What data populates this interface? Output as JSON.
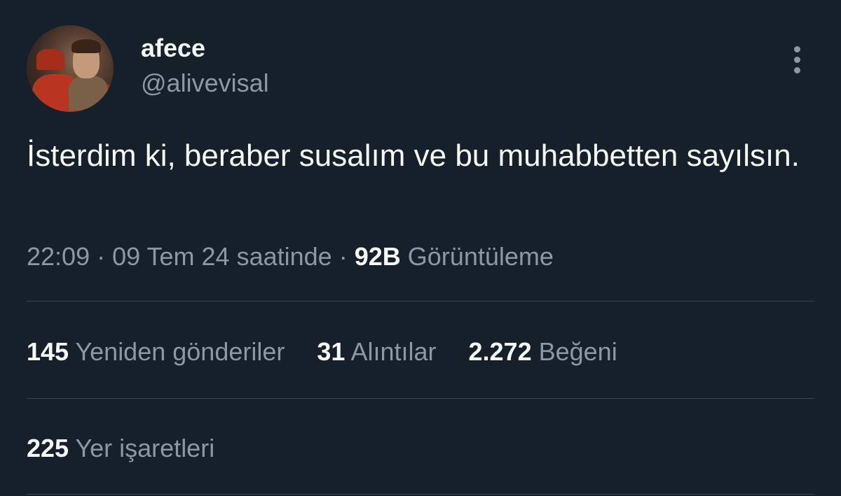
{
  "author": {
    "name": "afece",
    "handle": "@alivevisal"
  },
  "tweet": {
    "text": "İsterdim ki, beraber susalım ve bu muhabbetten sayılsın."
  },
  "meta": {
    "time": "22:09",
    "separator": "·",
    "date": "09 Tem 24 saatinde",
    "views_count": "92B",
    "views_label": "Görüntüleme"
  },
  "stats": {
    "retweets_count": "145",
    "retweets_label": "Yeniden gönderiler",
    "quotes_count": "31",
    "quotes_label": "Alıntılar",
    "likes_count": "2.272",
    "likes_label": "Beğeni",
    "bookmarks_count": "225",
    "bookmarks_label": "Yer işaretleri"
  },
  "icons": {
    "more": "more-vertical-icon"
  },
  "colors": {
    "background": "#15202b",
    "primary_text": "#f7f9f9",
    "secondary_text": "#8b98a5",
    "divider": "#38444d"
  }
}
